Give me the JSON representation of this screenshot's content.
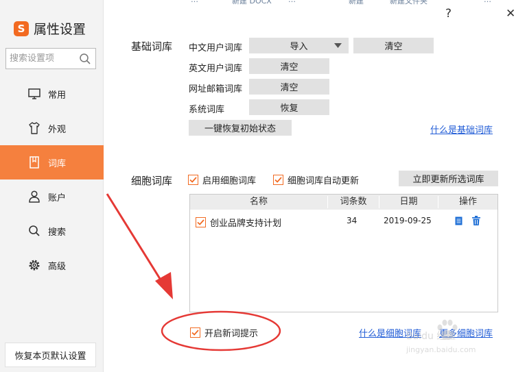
{
  "window": {
    "title": "属性设置",
    "help_label": "?",
    "close_label": "✕"
  },
  "background_tabs": [
    "…",
    "新建 DOCX",
    "…",
    "新建",
    "新建文件夹",
    "…"
  ],
  "sidebar": {
    "search_placeholder": "搜索设置项",
    "items": [
      {
        "label": "常用",
        "icon": "monitor-icon",
        "active": false
      },
      {
        "label": "外观",
        "icon": "tshirt-icon",
        "active": false
      },
      {
        "label": "词库",
        "icon": "book-icon",
        "active": true
      },
      {
        "label": "账户",
        "icon": "user-icon",
        "active": false
      },
      {
        "label": "搜索",
        "icon": "search-icon",
        "active": false
      },
      {
        "label": "高级",
        "icon": "gear-icon",
        "active": false
      }
    ],
    "reset_label": "恢复本页默认设置"
  },
  "basic": {
    "section_label": "基础词库",
    "rows": [
      {
        "label": "中文用户词库",
        "import_label": "导入",
        "action_label": "清空"
      },
      {
        "label": "英文用户词库",
        "action_label": "清空"
      },
      {
        "label": "网址邮箱词库",
        "action_label": "清空"
      },
      {
        "label": "系统词库",
        "action_label": "恢复"
      }
    ],
    "restore_all_label": "一键恢复初始状态",
    "help_link": "什么是基础词库"
  },
  "cell": {
    "section_label": "细胞词库",
    "enable_label": "启用细胞词库",
    "enable_checked": true,
    "auto_update_label": "细胞词库自动更新",
    "auto_update_checked": true,
    "update_button": "立即更新所选词库",
    "columns": [
      "名称",
      "词条数",
      "日期",
      "操作"
    ],
    "rows": [
      {
        "name": "创业品牌支持计划",
        "count": "34",
        "date": "2019-09-25",
        "checked": true
      }
    ],
    "new_word_label": "开启新词提示",
    "new_word_checked": true,
    "help_link": "什么是细胞词库",
    "more_link": "更多细胞词库"
  },
  "watermark": {
    "text": "Baidu 经验",
    "url": "jingyan.baidu.com"
  },
  "colors": {
    "accent": "#f5803e",
    "link": "#1f5bd6",
    "annotation": "#e53935",
    "button": "#e1e1e1"
  }
}
